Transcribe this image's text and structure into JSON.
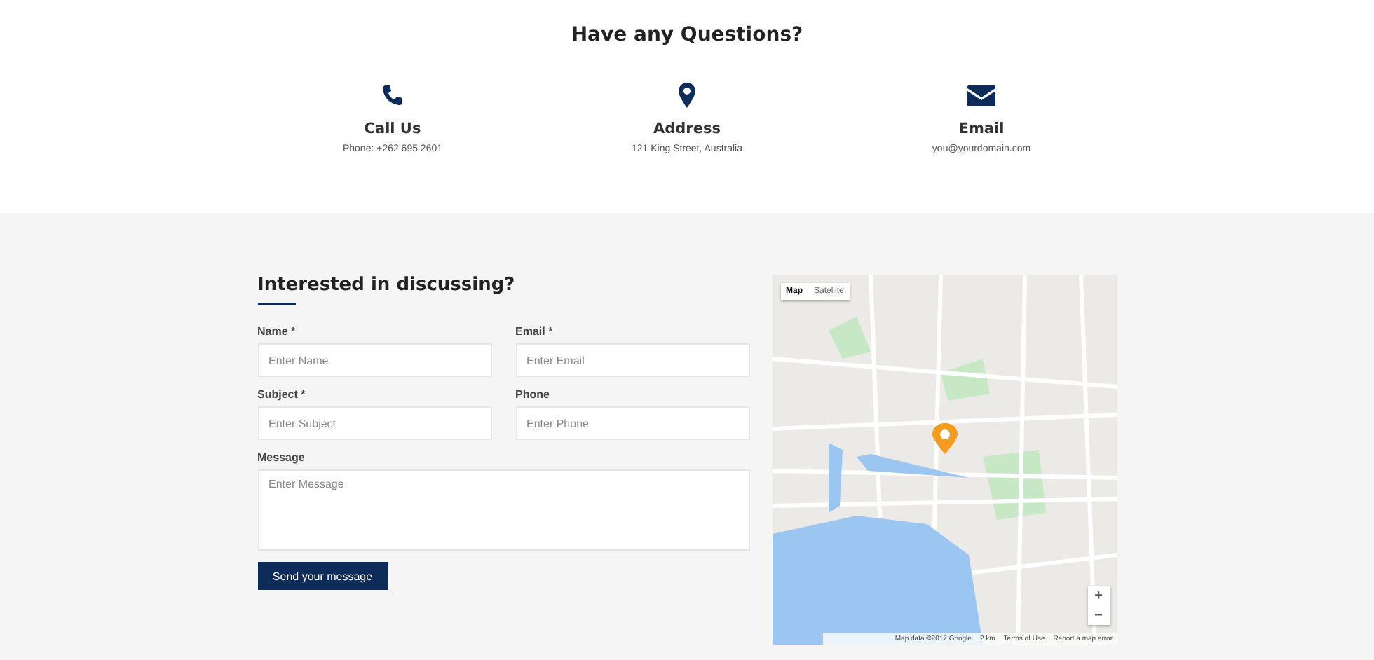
{
  "header": {
    "title": "Have any Questions?"
  },
  "contacts": [
    {
      "kind": "phone",
      "title": "Call Us",
      "detail": "Phone: +262 695 2601"
    },
    {
      "kind": "pin",
      "title": "Address",
      "detail": "121 King Street, Australia"
    },
    {
      "kind": "mail",
      "title": "Email",
      "detail": "you@yourdomain.com"
    }
  ],
  "form": {
    "title": "Interested in discussing?",
    "fields": [
      {
        "kind": "input",
        "label": "Name *",
        "placeholder": "Enter Name"
      },
      {
        "kind": "input",
        "label": "Email *",
        "placeholder": "Enter Email"
      },
      {
        "kind": "input",
        "label": "Subject *",
        "placeholder": "Enter Subject"
      },
      {
        "kind": "input",
        "label": "Phone",
        "placeholder": "Enter Phone"
      },
      {
        "kind": "textarea",
        "label": "Message",
        "placeholder": "Enter Message"
      }
    ],
    "submit": "Send your message"
  },
  "map": {
    "tabs": [
      {
        "label": "Map",
        "selected": true
      },
      {
        "label": "Satellite",
        "selected": false
      }
    ],
    "zoom_in": "+",
    "zoom_out": "−",
    "footer": [
      "Map data ©2017 Google",
      "2 km",
      "Terms of Use",
      "Report a map error"
    ]
  }
}
